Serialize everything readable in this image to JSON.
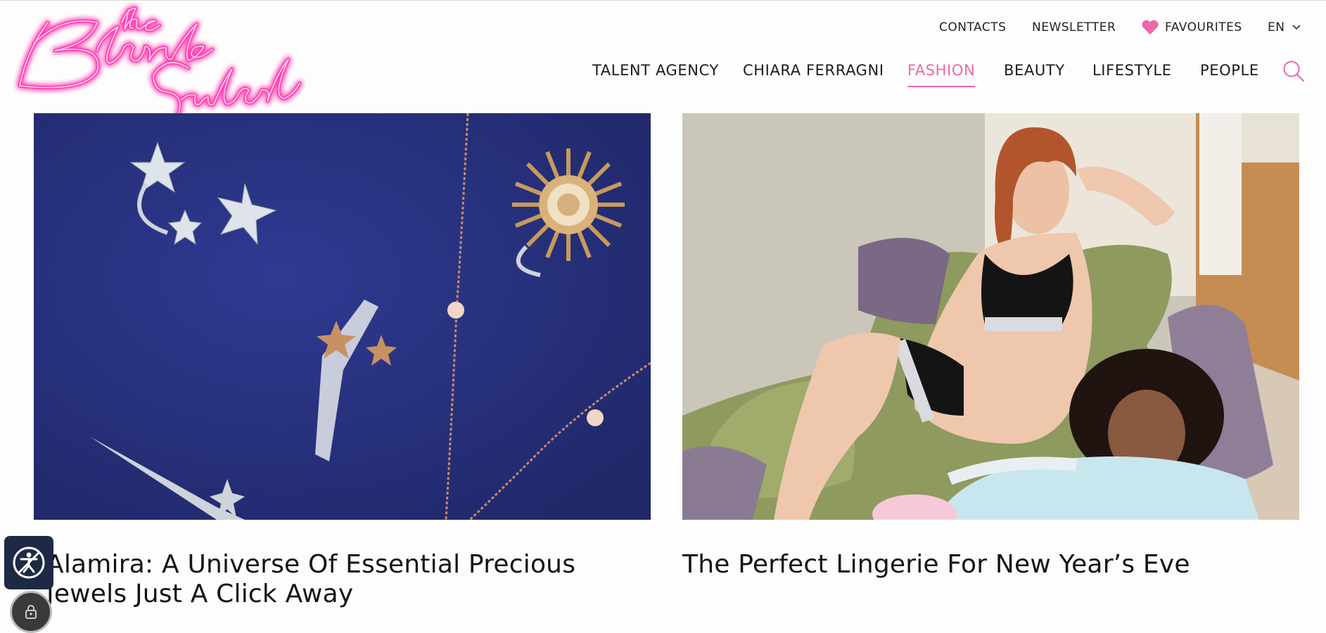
{
  "brand": {
    "logo_text": "the Blonde Salad"
  },
  "utility_nav": {
    "contacts": "CONTACTS",
    "newsletter": "NEWSLETTER",
    "favourites": "FAVOURITES",
    "language": "EN"
  },
  "main_nav": [
    {
      "label": "TALENT AGENCY"
    },
    {
      "label": "CHIARA FERRAGNI"
    },
    {
      "label": "FASHION",
      "active": true
    },
    {
      "label": "BEAUTY"
    },
    {
      "label": "LIFESTYLE"
    },
    {
      "label": "PEOPLE"
    }
  ],
  "articles": [
    {
      "title": "Alamira: A Universe Of Essential Precious Jewels Just A Click Away",
      "image": "jewels on navy background"
    },
    {
      "title": "The Perfect Lingerie For New Year’s Eve",
      "image": "two models in lingerie on green sofa"
    }
  ],
  "colors": {
    "accent": "#ef66ab",
    "navy": "#27307c",
    "a11y_bg": "#1e2a45"
  },
  "icons": [
    "heart-icon",
    "chevron-down-icon",
    "search-icon",
    "accessibility-icon",
    "lock-icon"
  ]
}
